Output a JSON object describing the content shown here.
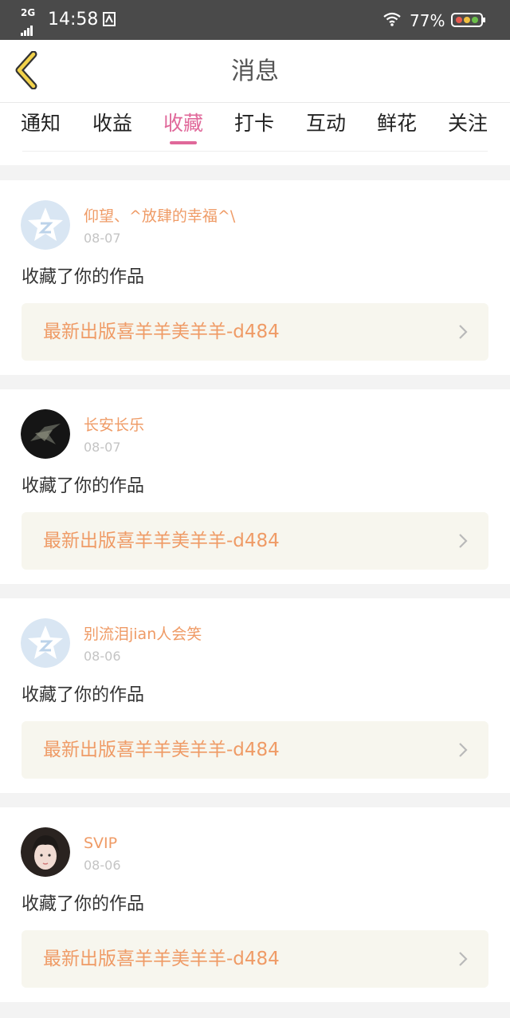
{
  "status_bar": {
    "network": "2G",
    "time": "14:58",
    "battery_pct": "77%"
  },
  "header": {
    "title": "消息",
    "back_icon": "back-chevron-icon"
  },
  "tabs": [
    {
      "label": "通知",
      "active": false
    },
    {
      "label": "收益",
      "active": false
    },
    {
      "label": "收藏",
      "active": true
    },
    {
      "label": "打卡",
      "active": false
    },
    {
      "label": "互动",
      "active": false
    },
    {
      "label": "鲜花",
      "active": false
    },
    {
      "label": "关注",
      "active": false
    }
  ],
  "colors": {
    "accent_pink": "#e0689a",
    "name_orange": "#ef9b66",
    "card_bg": "#f7f6ee"
  },
  "items": [
    {
      "user": "仰望、^放肆的幸福^\\",
      "date": "08-07",
      "action": "收藏了你的作品",
      "work": "最新出版喜羊羊美羊羊-d484",
      "avatar": "default-star-avatar"
    },
    {
      "user": "长安长乐",
      "date": "08-07",
      "action": "收藏了你的作品",
      "work": "最新出版喜羊羊美羊羊-d484",
      "avatar": "photo-avatar-dark"
    },
    {
      "user": "别流泪jian人会笑",
      "date": "08-06",
      "action": "收藏了你的作品",
      "work": "最新出版喜羊羊美羊羊-d484",
      "avatar": "default-star-avatar"
    },
    {
      "user": "SVIP",
      "date": "08-06",
      "action": "收藏了你的作品",
      "work": "最新出版喜羊羊美羊羊-d484",
      "avatar": "photo-avatar-girl"
    }
  ]
}
